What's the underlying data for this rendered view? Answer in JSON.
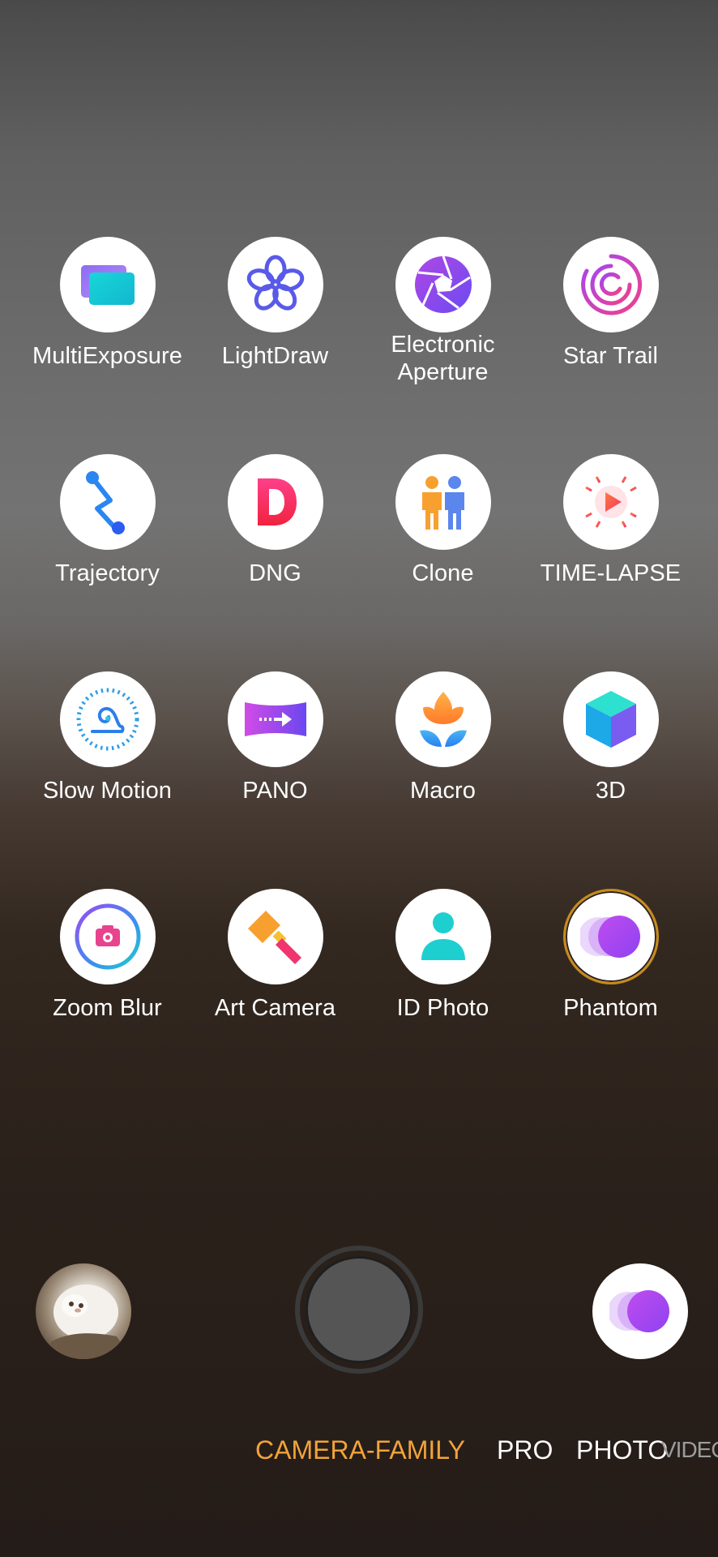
{
  "modes": [
    {
      "label": "MultiExposure",
      "icon": "multiexposure-icon"
    },
    {
      "label": "LightDraw",
      "icon": "lightdraw-icon"
    },
    {
      "label": "Electronic\nAperture",
      "icon": "aperture-icon"
    },
    {
      "label": "Star Trail",
      "icon": "star-trail-icon"
    },
    {
      "label": "Trajectory",
      "icon": "trajectory-icon"
    },
    {
      "label": "DNG",
      "icon": "dng-icon"
    },
    {
      "label": "Clone",
      "icon": "clone-icon"
    },
    {
      "label": "TIME-LAPSE",
      "icon": "time-lapse-icon"
    },
    {
      "label": "Slow Motion",
      "icon": "slow-motion-icon"
    },
    {
      "label": "PANO",
      "icon": "pano-icon"
    },
    {
      "label": "Macro",
      "icon": "macro-icon"
    },
    {
      "label": "3D",
      "icon": "3d-icon"
    },
    {
      "label": "Zoom Blur",
      "icon": "zoom-blur-icon"
    },
    {
      "label": "Art Camera",
      "icon": "art-camera-icon"
    },
    {
      "label": "ID Photo",
      "icon": "id-photo-icon"
    },
    {
      "label": "Phantom",
      "icon": "phantom-icon",
      "selected": true
    }
  ],
  "tabs": {
    "camera_family": "CAMERA-FAMILY",
    "pro": "PRO",
    "photo": "PHOTO",
    "video": "VIDEO"
  },
  "colors": {
    "active_tab": "#f2a33a",
    "selected_ring": "#c78a1c"
  }
}
